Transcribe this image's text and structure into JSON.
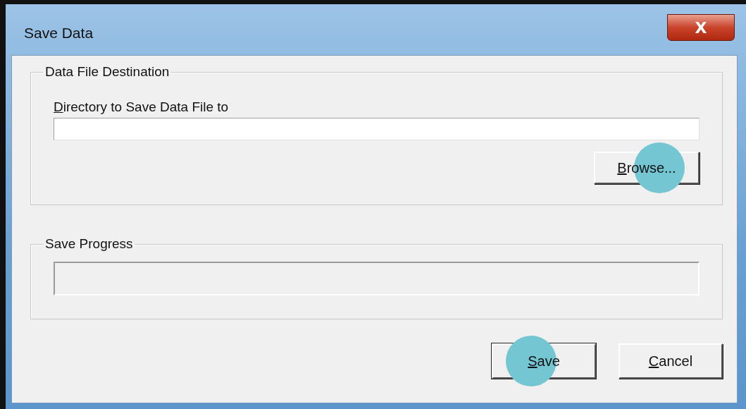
{
  "window": {
    "title": "Save Data",
    "close_label": "X"
  },
  "destination": {
    "title": "Data File Destination",
    "field_label": "Directory to Save Data File to",
    "field_label_underline_first": true,
    "browse": {
      "label": "Browse...",
      "underline_first": true,
      "highlighted": true
    }
  },
  "progress": {
    "title": "Save Progress",
    "level": 0
  },
  "buttons": [
    {
      "label": "Save",
      "underline_first": true,
      "highlighted": true,
      "default": true
    },
    {
      "label": "Cancel",
      "underline_first": true,
      "highlighted": false,
      "default": false
    }
  ]
}
